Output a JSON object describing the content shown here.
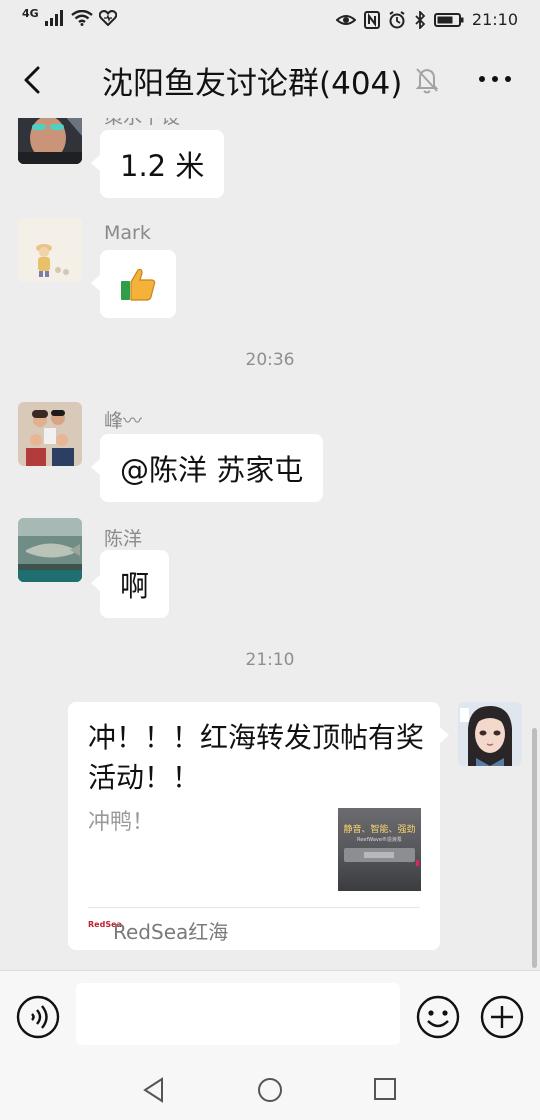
{
  "status_bar": {
    "network": "4G",
    "time": "21:10",
    "icons": [
      "signal-icon",
      "wifi-icon",
      "heart-icon",
      "eye-icon",
      "nfc-icon",
      "alarm-icon",
      "bluetooth-icon",
      "battery-icon"
    ]
  },
  "header": {
    "title": "沈阳鱼友讨论群(404)",
    "back_icon": "chevron-left-icon",
    "mute_icon": "bell-off-icon",
    "more_icon": "more-icon"
  },
  "messages": [
    {
      "sender": "策水下设",
      "text": "1.2 米",
      "avatar": "avatar-man-sunglasses"
    },
    {
      "sender": "Mark",
      "text": "👍",
      "avatar": "avatar-cartoon-figure"
    },
    {
      "time": "20:36"
    },
    {
      "sender": "峰〰",
      "text": "@陈洋  苏家屯",
      "avatar": "avatar-family-photo"
    },
    {
      "sender": "陈洋",
      "text": "啊",
      "avatar": "avatar-fish-tank"
    },
    {
      "time": "21:10"
    },
    {
      "self": true,
      "type": "link_card",
      "title": "冲！！！红海转发顶帖有奖活动！！",
      "description": "冲鸭！",
      "thumbnail_text": "静音、智能、强劲",
      "thumbnail_sub": "ReefWave®造浪泵",
      "source_logo": "RedSea",
      "source": "RedSea红海",
      "avatar": "avatar-anime-girl"
    }
  ],
  "input_bar": {
    "voice_icon": "voice-icon",
    "input_placeholder": "",
    "emoji_icon": "emoji-icon",
    "plus_icon": "plus-icon"
  },
  "nav_bar": {
    "icons": [
      "nav-back-icon",
      "nav-home-icon",
      "nav-recent-icon"
    ]
  },
  "colors": {
    "background": "#ededed",
    "bubble": "#ffffff",
    "timestamp": "#8f8f8f",
    "sender_name": "#8a8a8a"
  }
}
